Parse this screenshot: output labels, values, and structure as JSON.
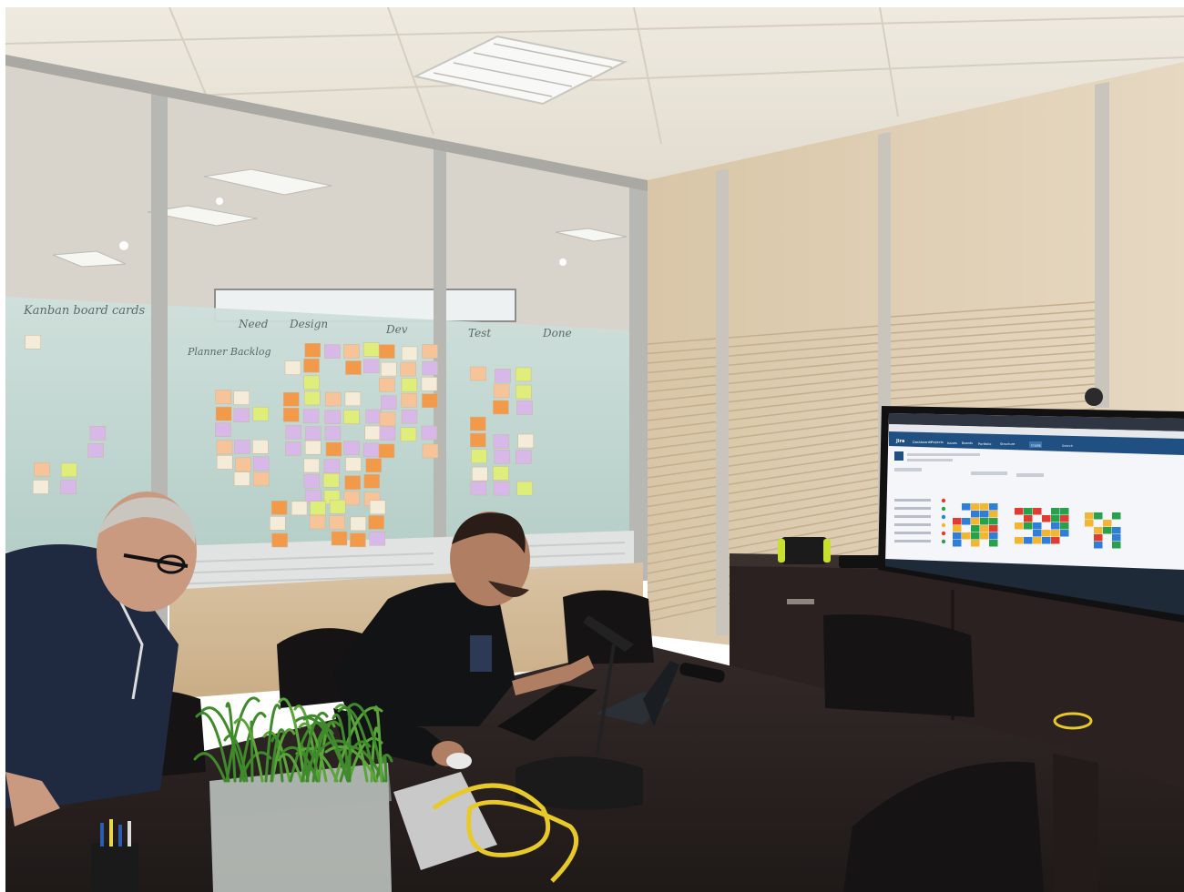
{
  "photo": {
    "description_visible_only": true,
    "palette": {
      "ceiling": "#e9e4da",
      "glass": "#b9d2cc",
      "wall_wood": "#dcc9ad",
      "table": "#2b2322",
      "screen_bg": "#f4f6f9",
      "jira_blue": "#205081"
    }
  },
  "whiteboard": {
    "headers": [
      "Need",
      "Design",
      "Dev",
      "Test",
      "Done"
    ],
    "side_label": "Planner Backlog",
    "title_scrawl": "Kanban board cards"
  },
  "tv_screen": {
    "app_name": "Jira",
    "nav_items": [
      "Dashboards",
      "Projects",
      "Issues",
      "Boards",
      "Portfolio",
      "Structure",
      "Create"
    ],
    "search_placeholder": "Search"
  }
}
